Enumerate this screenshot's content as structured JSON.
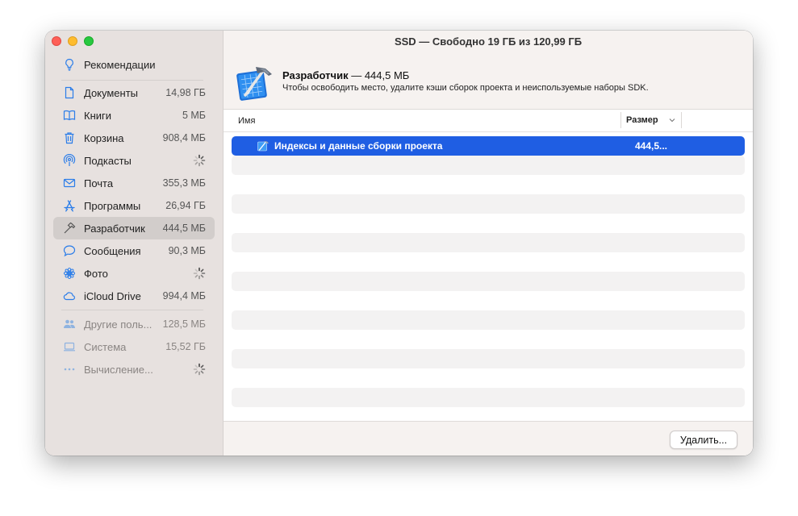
{
  "window_title": "SSD — Свободно 19 ГБ из 120,99 ГБ",
  "sidebar": {
    "recommendations": {
      "label": "Рекомендации",
      "icon": "lightbulb-icon"
    },
    "items": [
      {
        "label": "Документы",
        "value": "14,98 ГБ",
        "icon": "document-icon"
      },
      {
        "label": "Книги",
        "value": "5 МБ",
        "icon": "book-icon"
      },
      {
        "label": "Корзина",
        "value": "908,4 МБ",
        "icon": "trash-icon"
      },
      {
        "label": "Подкасты",
        "value": "",
        "icon": "podcast-icon",
        "loading": true
      },
      {
        "label": "Почта",
        "value": "355,3 МБ",
        "icon": "envelope-icon"
      },
      {
        "label": "Программы",
        "value": "26,94 ГБ",
        "icon": "app-store-icon"
      },
      {
        "label": "Разработчик",
        "value": "444,5 МБ",
        "icon": "hammer-icon",
        "selected": true
      },
      {
        "label": "Сообщения",
        "value": "90,3 МБ",
        "icon": "message-bubble-icon"
      },
      {
        "label": "Фото",
        "value": "",
        "icon": "photos-flower-icon",
        "loading": true
      },
      {
        "label": "iCloud Drive",
        "value": "994,4 МБ",
        "icon": "cloud-icon"
      }
    ],
    "other_items": [
      {
        "label": "Другие поль...",
        "value": "128,5 МБ",
        "icon": "users-icon"
      },
      {
        "label": "Система",
        "value": "15,52 ГБ",
        "icon": "laptop-icon"
      },
      {
        "label": "Вычисление...",
        "value": "",
        "icon": "ellipsis-icon",
        "loading": true
      }
    ]
  },
  "header": {
    "title": "Разработчик",
    "title_suffix": " — 444,5 МБ",
    "subtitle": "Чтобы освободить место, удалите кэши сборок проекта и неиспользуемые наборы SDK."
  },
  "table": {
    "columns": {
      "name": "Имя",
      "size": "Размер"
    },
    "rows": [
      {
        "name": "Индексы и данные сборки проекта",
        "size": "444,5...",
        "selected": true
      }
    ]
  },
  "footer": {
    "delete_label": "Удалить..."
  },
  "colors": {
    "accent": "#1f5ee3",
    "sidebar_bg": "#e7e1df",
    "icon_blue": "#2b7de9"
  }
}
